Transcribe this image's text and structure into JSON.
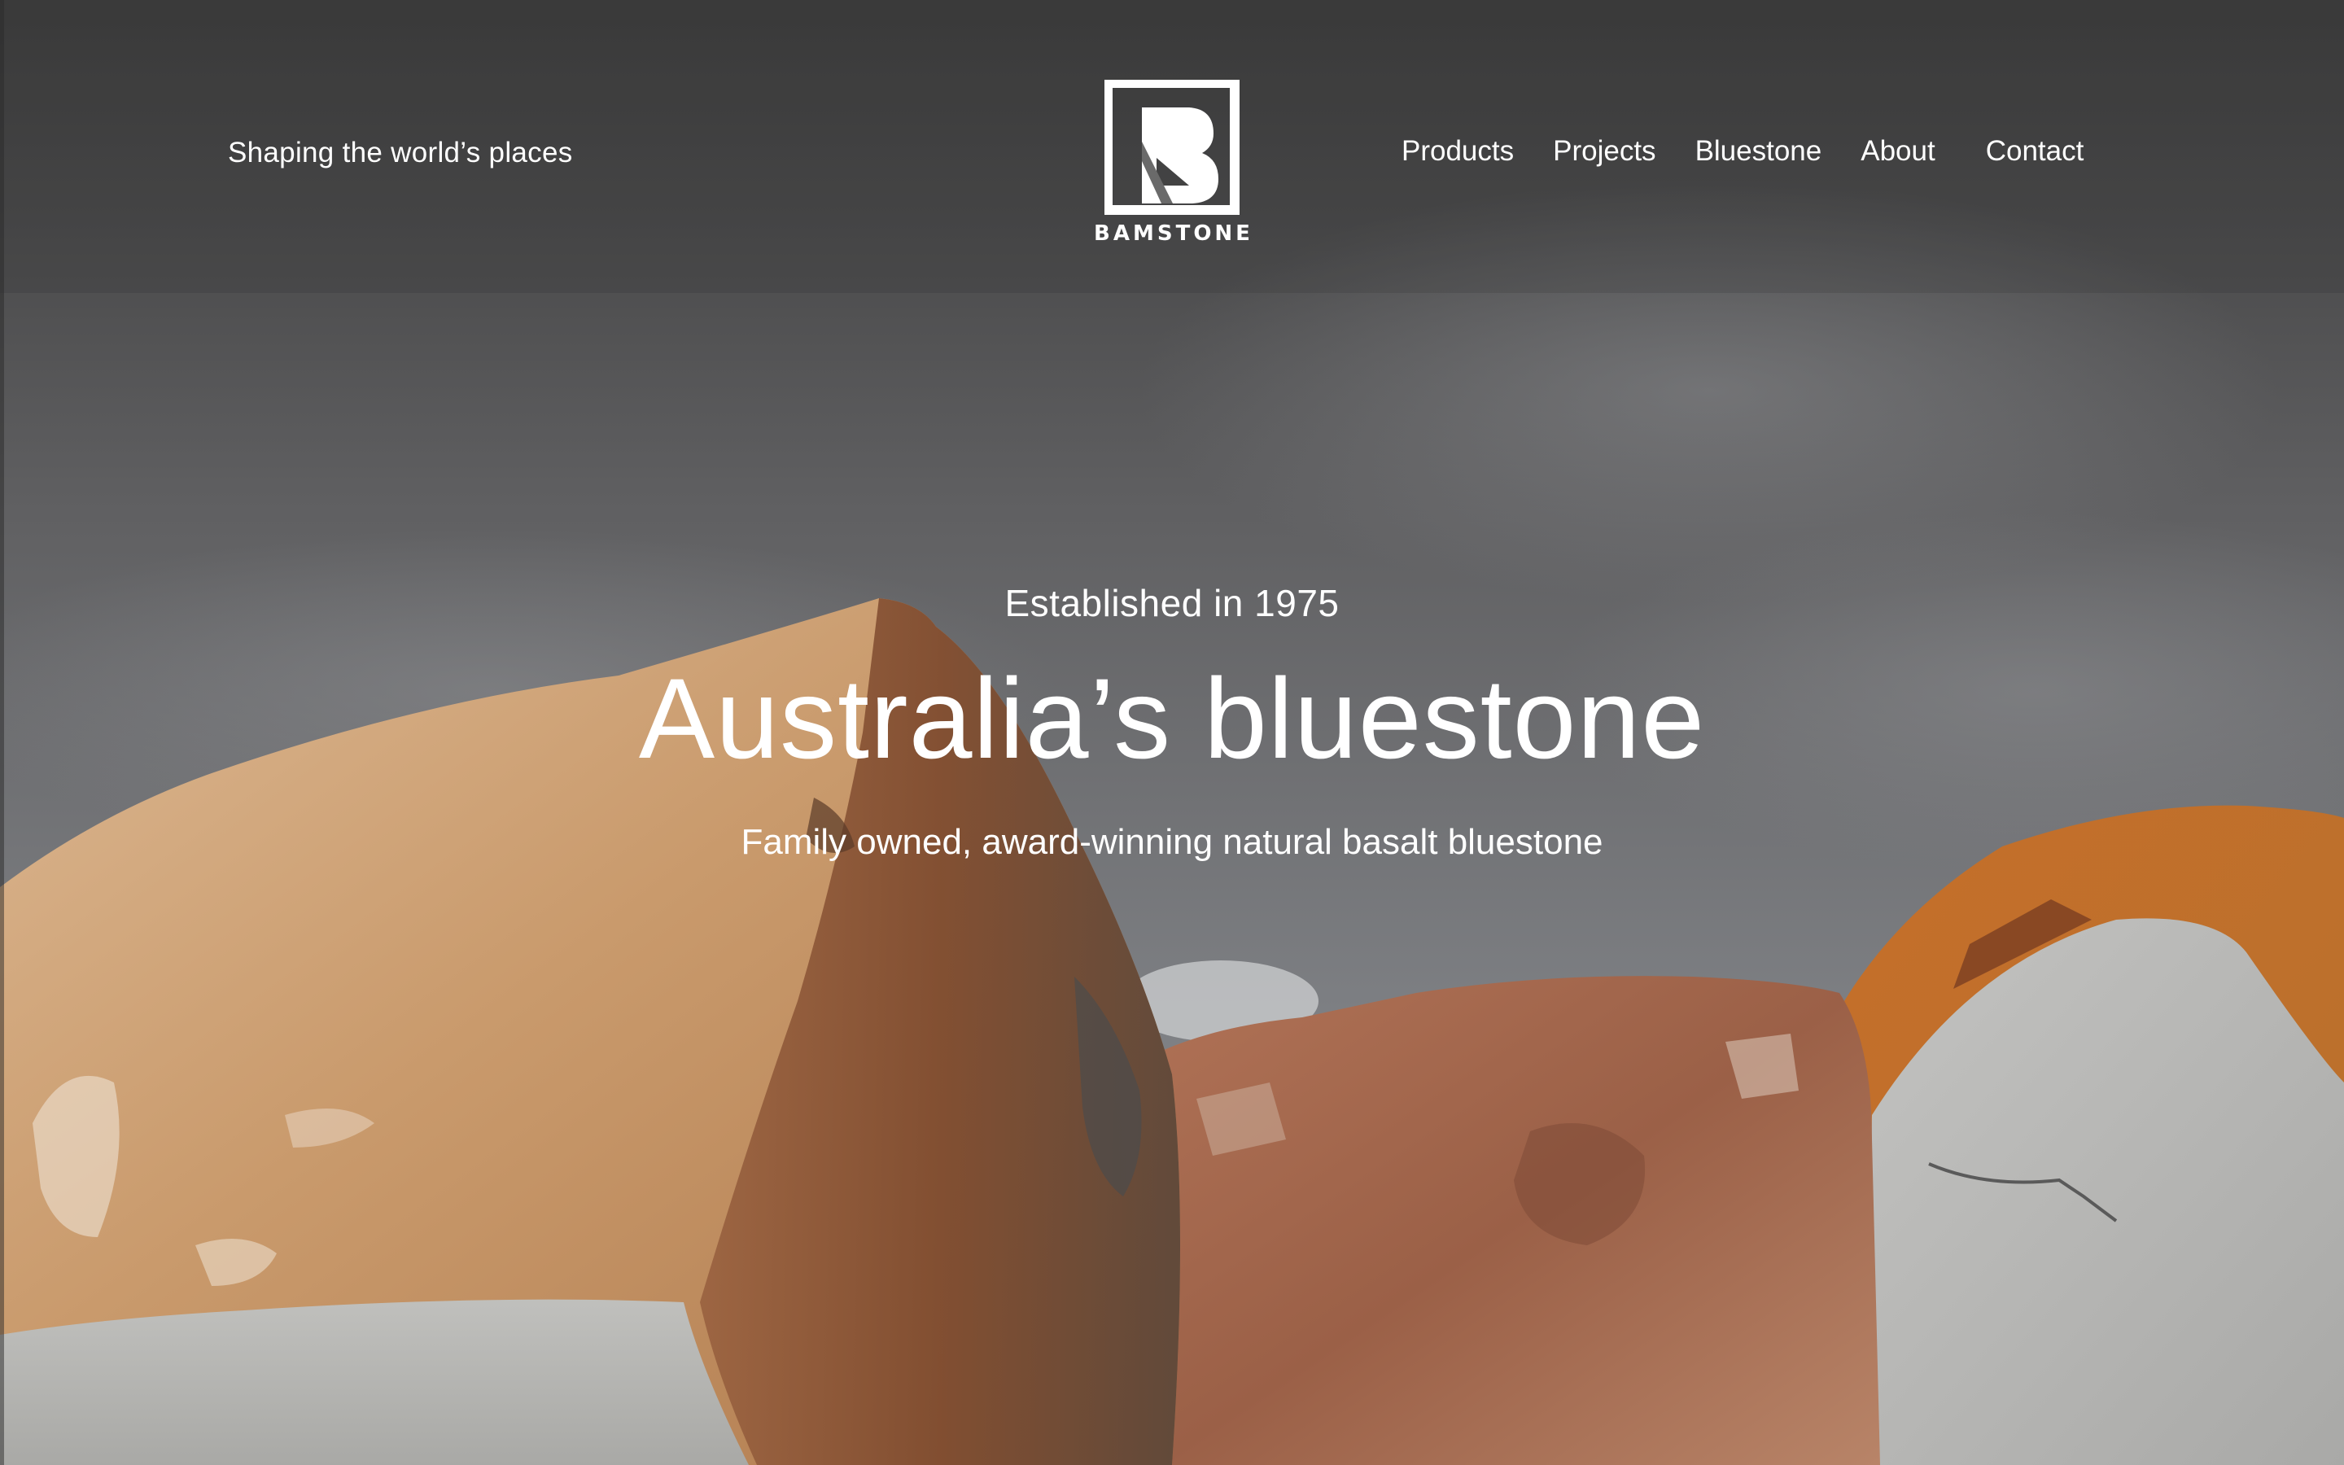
{
  "header": {
    "tagline": "Shaping the world’s places",
    "logo_text": "BAMSTONE",
    "nav": [
      {
        "label": "Products"
      },
      {
        "label": "Projects"
      },
      {
        "label": "Bluestone"
      },
      {
        "label": "About"
      },
      {
        "label": "Contact"
      }
    ]
  },
  "hero": {
    "eyebrow": "Established in 1975",
    "headline": "Australia’s bluestone",
    "subline": "Family owned, award-winning natural basalt bluestone",
    "background_image": "rock-boulders-photo"
  },
  "colors": {
    "text": "#ffffff",
    "sky": "#6e6f72",
    "rock_tan": "#c9986a",
    "rock_rust": "#9a5a38",
    "ground": "#b9b9b7"
  }
}
